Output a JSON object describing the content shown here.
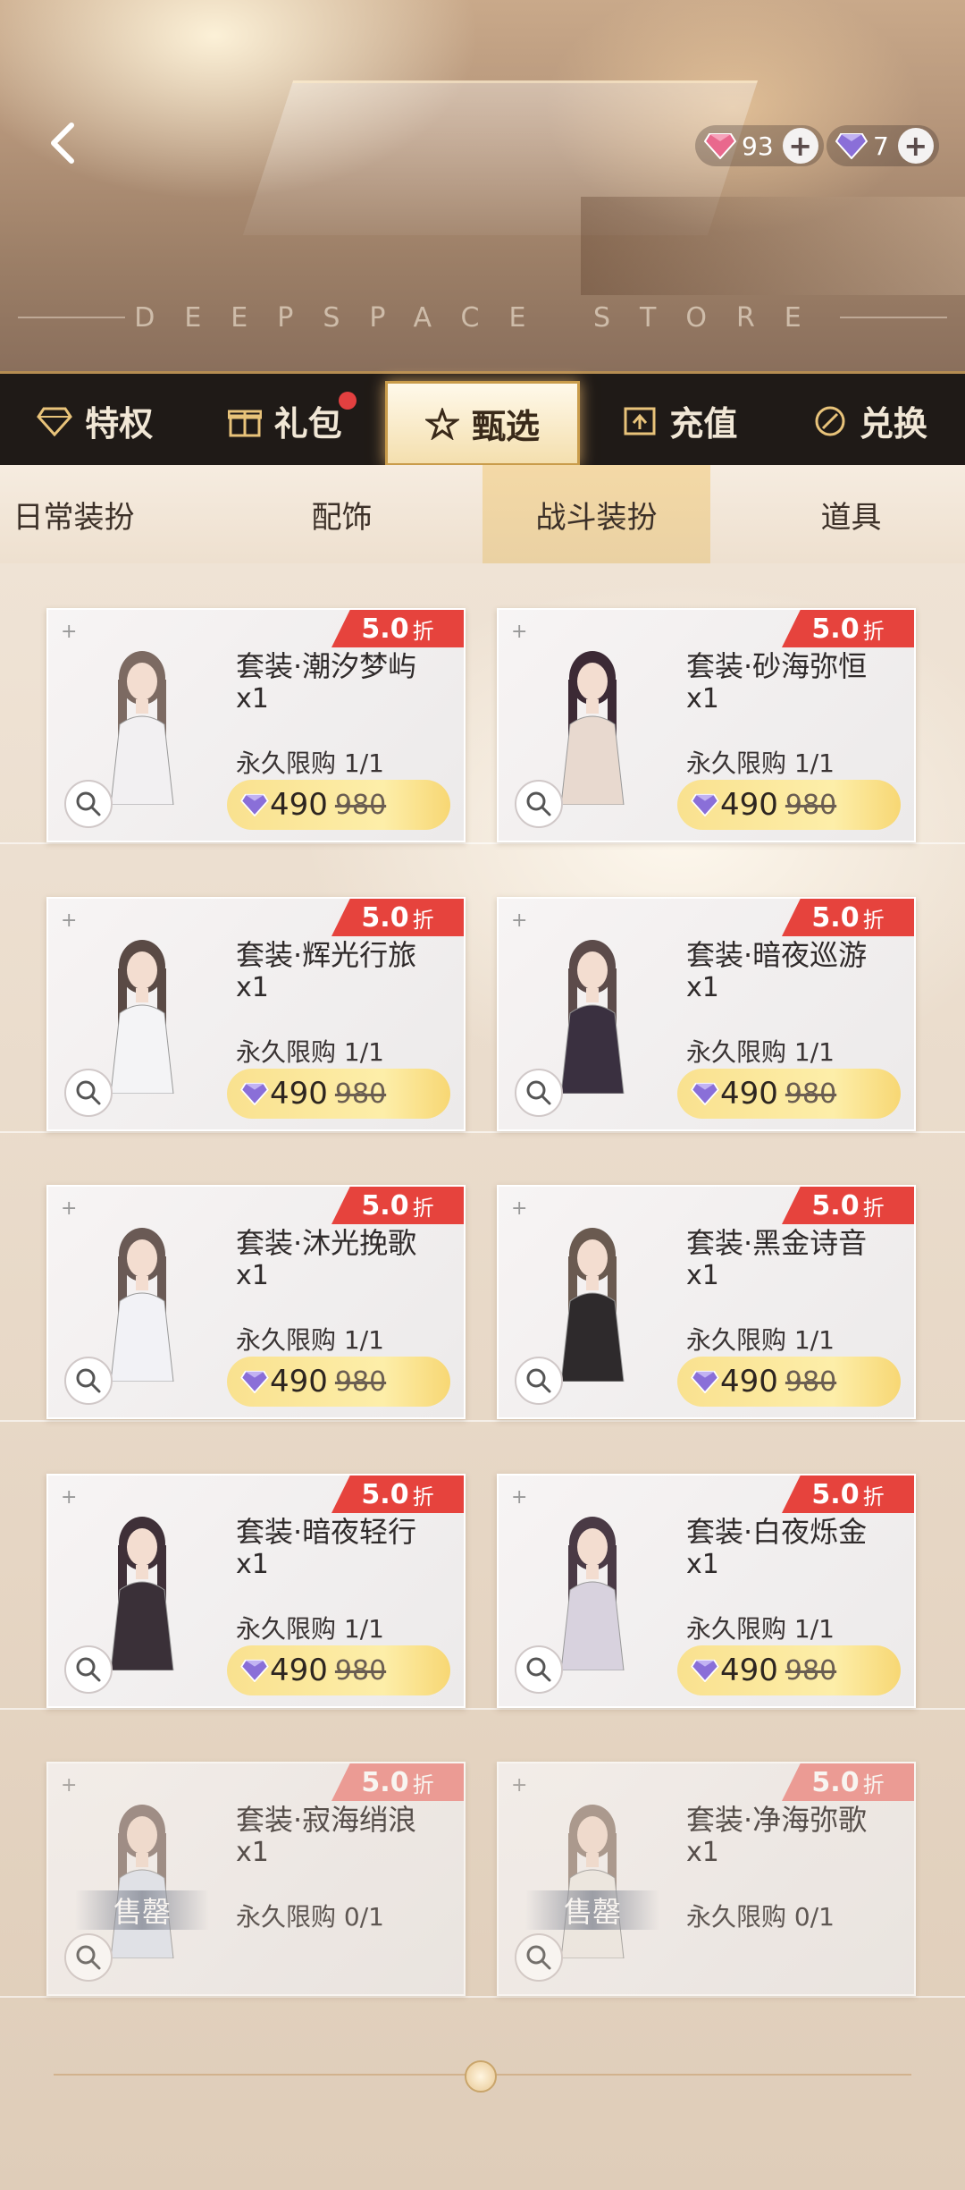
{
  "header": {
    "store_title": "DEEPSPACE STORE",
    "currencies": [
      {
        "icon": "pink-gem-icon",
        "amount": "93"
      },
      {
        "icon": "purple-gem-icon",
        "amount": "7"
      }
    ]
  },
  "main_tabs": [
    {
      "label": "特权",
      "icon": "diamond-icon"
    },
    {
      "label": "礼包",
      "icon": "gift-icon"
    },
    {
      "label": "甄选",
      "icon": "star-icon"
    },
    {
      "label": "充值",
      "icon": "topup-icon"
    },
    {
      "label": "兑换",
      "icon": "exchange-icon"
    }
  ],
  "sub_tabs": [
    "日常装扮",
    "配饰",
    "战斗装扮",
    "道具"
  ],
  "items": [
    {
      "name": "套装·潮汐梦屿",
      "qty": "x1",
      "limit": "永久限购 1/1",
      "discount": "5.0",
      "discount_unit": "折",
      "price": "490",
      "original_price": "980",
      "sold_out": false
    },
    {
      "name": "套装·砂海弥恒",
      "qty": "x1",
      "limit": "永久限购 1/1",
      "discount": "5.0",
      "discount_unit": "折",
      "price": "490",
      "original_price": "980",
      "sold_out": false
    },
    {
      "name": "套装·辉光行旅",
      "qty": "x1",
      "limit": "永久限购 1/1",
      "discount": "5.0",
      "discount_unit": "折",
      "price": "490",
      "original_price": "980",
      "sold_out": false
    },
    {
      "name": "套装·暗夜巡游",
      "qty": "x1",
      "limit": "永久限购 1/1",
      "discount": "5.0",
      "discount_unit": "折",
      "price": "490",
      "original_price": "980",
      "sold_out": false
    },
    {
      "name": "套装·沐光挽歌",
      "qty": "x1",
      "limit": "永久限购 1/1",
      "discount": "5.0",
      "discount_unit": "折",
      "price": "490",
      "original_price": "980",
      "sold_out": false
    },
    {
      "name": "套装·黑金诗音",
      "qty": "x1",
      "limit": "永久限购 1/1",
      "discount": "5.0",
      "discount_unit": "折",
      "price": "490",
      "original_price": "980",
      "sold_out": false
    },
    {
      "name": "套装·暗夜轻行",
      "qty": "x1",
      "limit": "永久限购 1/1",
      "discount": "5.0",
      "discount_unit": "折",
      "price": "490",
      "original_price": "980",
      "sold_out": false
    },
    {
      "name": "套装·白夜烁金",
      "qty": "x1",
      "limit": "永久限购 1/1",
      "discount": "5.0",
      "discount_unit": "折",
      "price": "490",
      "original_price": "980",
      "sold_out": false
    },
    {
      "name": "套装·寂海绡浪",
      "qty": "x1",
      "limit": "永久限购 0/1",
      "discount": "5.0",
      "discount_unit": "折",
      "sold_out": true,
      "sold_out_label": "售罄"
    },
    {
      "name": "套装·净海弥歌",
      "qty": "x1",
      "limit": "永久限购 0/1",
      "discount": "5.0",
      "discount_unit": "折",
      "sold_out": true,
      "sold_out_label": "售罄"
    }
  ],
  "colors": {
    "accent_gold": "#c99c4b",
    "discount_red": "#e6433d",
    "tab_bar_bg": "#1f1a17"
  }
}
